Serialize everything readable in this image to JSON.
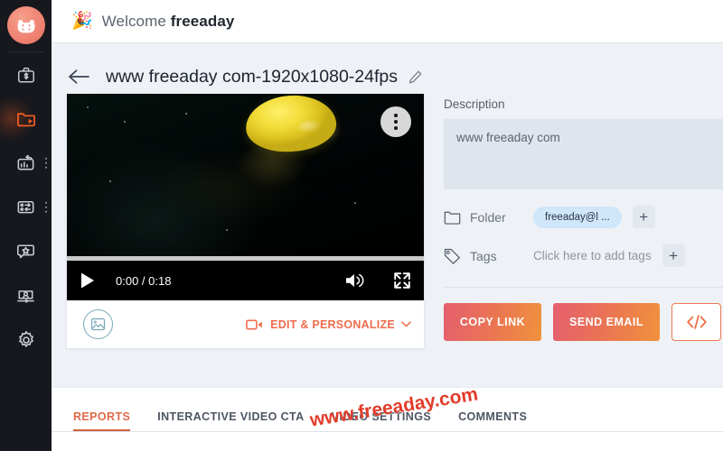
{
  "app": {
    "avatar_alt": "user-avatar",
    "accent_orange": "#ec5b23",
    "accent_coral": "#ee6b4d",
    "sidebar_bg": "#16181d"
  },
  "header": {
    "party_icon": "🎉",
    "welcome_prefix": "Welcome ",
    "username": "freeaday"
  },
  "sidebar": {
    "items": [
      {
        "name": "briefcase-dollar",
        "label": "Sales",
        "active": false,
        "kebab": false
      },
      {
        "name": "folder-video",
        "label": "Video Library",
        "active": true,
        "kebab": false
      },
      {
        "name": "analytics-report",
        "label": "Analytics",
        "active": false,
        "kebab": true
      },
      {
        "name": "integrations",
        "label": "Integrations",
        "active": false,
        "kebab": true
      },
      {
        "name": "chat-star",
        "label": "Feedback",
        "active": false,
        "kebab": false
      },
      {
        "name": "user-flow",
        "label": "Contacts",
        "active": false,
        "kebab": false
      },
      {
        "name": "gear",
        "label": "Settings",
        "active": false,
        "kebab": false
      }
    ]
  },
  "page": {
    "back_label": "Back",
    "title": "www freeaday com-1920x1080-24fps",
    "edit_title_label": "Rename"
  },
  "video": {
    "current_time": "0:00",
    "duration": "0:18",
    "time_display": "0:00 / 0:18",
    "progress_percent": 0,
    "play_label": "Play",
    "volume_label": "Mute",
    "fullscreen_label": "Fullscreen",
    "kebab_label": "More options",
    "thumbnail_label": "Change thumbnail",
    "edit_personalize_label": "EDIT & PERSONALIZE"
  },
  "details": {
    "description_label": "Description",
    "description_value": "www freeaday com",
    "folder_label": "Folder",
    "folder_chip": "freeaday@l ...",
    "folder_add_label": "+",
    "tags_label": "Tags",
    "tags_placeholder": "Click here to add tags",
    "tags_add_label": "+"
  },
  "actions": {
    "copy_link": "COPY LINK",
    "send_email": "SEND EMAIL",
    "embed_label": "</>"
  },
  "tabs": [
    {
      "label": "REPORTS",
      "active": true
    },
    {
      "label": "INTERACTIVE VIDEO CTA",
      "active": false
    },
    {
      "label": "VIDEO SETTINGS",
      "active": false
    },
    {
      "label": "COMMENTS",
      "active": false
    }
  ],
  "watermark": {
    "text": "www.freeaday.com",
    "color": "#e23c2a"
  }
}
